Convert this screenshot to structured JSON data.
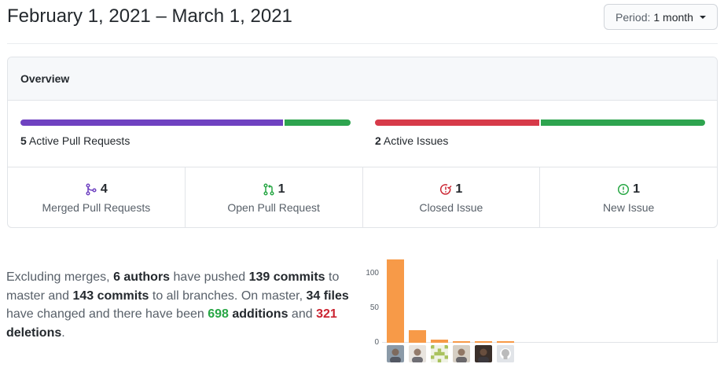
{
  "header": {
    "date_range": "February 1, 2021 – March 1, 2021",
    "period_label": "Period:",
    "period_value": "1 month"
  },
  "overview": {
    "title": "Overview",
    "pull_requests": {
      "count": "5",
      "label": "Active Pull Requests",
      "merged_fraction": 0.8,
      "open_fraction": 0.2,
      "merged_color": "#6f42c1",
      "open_color": "#2ea44f"
    },
    "issues": {
      "count": "2",
      "label": "Active Issues",
      "closed_fraction": 0.5,
      "new_fraction": 0.5,
      "closed_color": "#d73a49",
      "new_color": "#2ea44f"
    },
    "counts": [
      {
        "value": "4",
        "label": "Merged Pull Requests",
        "icon": "merge-icon",
        "color": "#6f42c1"
      },
      {
        "value": "1",
        "label": "Open Pull Request",
        "icon": "pull-request-icon",
        "color": "#28a745"
      },
      {
        "value": "1",
        "label": "Closed Issue",
        "icon": "issue-closed-icon",
        "color": "#cb2431"
      },
      {
        "value": "1",
        "label": "New Issue",
        "icon": "issue-opened-icon",
        "color": "#28a745"
      }
    ]
  },
  "summary": {
    "t1": "Excluding merges, ",
    "authors": "6 authors",
    "t2": " have pushed ",
    "commits_master": "139 commits",
    "t3": " to master and ",
    "commits_all": "143 commits",
    "t4": " to all branches. On master, ",
    "files": "34 files",
    "t5": " have changed and there have been ",
    "additions_num": "698",
    "additions_word": " additions",
    "t6": " and ",
    "deletions_num": "321",
    "deletions_word": " deletions",
    "t7": "."
  },
  "chart_data": {
    "type": "bar",
    "title": "",
    "xlabel": "",
    "ylabel": "",
    "ylim": [
      0,
      120
    ],
    "yticks": [
      "100",
      "50",
      "0"
    ],
    "categories": [
      "author-1",
      "author-2",
      "author-3",
      "author-4",
      "author-5",
      "author-6"
    ],
    "values": [
      120,
      18,
      4,
      2,
      2,
      2
    ],
    "bar_color": "#f79a48",
    "avatars": [
      "person-avatar",
      "person-avatar",
      "identicon-avatar",
      "person-avatar",
      "person-avatar",
      "github-default-avatar"
    ]
  }
}
